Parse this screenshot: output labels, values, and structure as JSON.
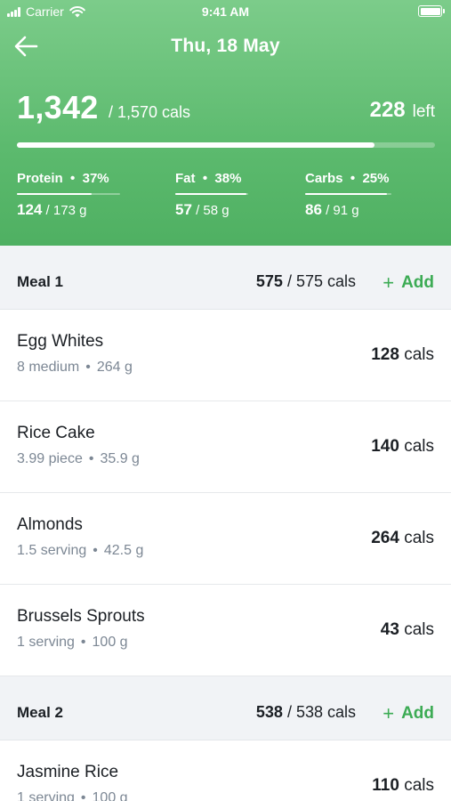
{
  "status_bar": {
    "carrier": "Carrier",
    "time": "9:41 AM"
  },
  "header": {
    "date": "Thu, 18 May",
    "eaten": "1,342",
    "goal": "/ 1,570 cals",
    "left_value": "228",
    "left_label": "left",
    "progress": 0.855
  },
  "macros": [
    {
      "name": "Protein",
      "percent": "37%",
      "amount": "124",
      "target": "/ 173 g",
      "progress": 0.72
    },
    {
      "name": "Fat",
      "percent": "38%",
      "amount": "57",
      "target": "/ 58 g",
      "progress": 0.98
    },
    {
      "name": "Carbs",
      "percent": "25%",
      "amount": "86",
      "target": "/ 91 g",
      "progress": 0.95
    }
  ],
  "meals": [
    {
      "title": "Meal 1",
      "eaten": "575",
      "goal": "/ 575 cals",
      "add_label": "Add",
      "foods": [
        {
          "name": "Egg Whites",
          "qty": "8 medium",
          "weight": "264 g",
          "cals": "128",
          "unit": "cals"
        },
        {
          "name": "Rice Cake",
          "qty": "3.99 piece",
          "weight": "35.9 g",
          "cals": "140",
          "unit": "cals"
        },
        {
          "name": "Almonds",
          "qty": "1.5 serving",
          "weight": "42.5 g",
          "cals": "264",
          "unit": "cals"
        },
        {
          "name": "Brussels Sprouts",
          "qty": "1 serving",
          "weight": "100 g",
          "cals": "43",
          "unit": "cals"
        }
      ]
    },
    {
      "title": "Meal 2",
      "eaten": "538",
      "goal": "/ 538 cals",
      "add_label": "Add",
      "foods": [
        {
          "name": "Jasmine Rice",
          "qty": "1 serving",
          "weight": "100 g",
          "cals": "110",
          "unit": "cals"
        }
      ]
    }
  ],
  "colors": {
    "header_top": "#7ccc8a",
    "header_bottom": "#4fb062",
    "accent": "#3cab54",
    "section_bg": "#f1f3f6",
    "muted_text": "#7c8794"
  },
  "icons": {
    "back": "arrow-left-icon",
    "signal": "signal-icon",
    "wifi": "wifi-icon",
    "battery": "battery-icon",
    "add": "plus-icon"
  }
}
